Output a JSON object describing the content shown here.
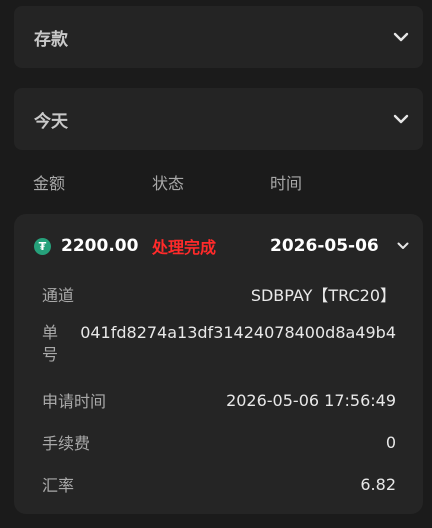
{
  "filters": {
    "type_label": "存款",
    "date_label": "今天"
  },
  "columns": [
    "金额",
    "状态",
    "时间"
  ],
  "record": {
    "coin_icon": "tether-icon",
    "coin_symbol": "₮",
    "amount": "2200.00",
    "status": "处理完成",
    "status_color": "#ff2a2a",
    "date": "2026-05-06",
    "details": {
      "channel_label": "通道",
      "channel_value": "SDBPAY【TRC20】",
      "order_label": "单号",
      "order_value": "041fd8274a13df31424078400d8a49b4",
      "time_label": "申请时间",
      "time_value": "2026-05-06 17:56:49",
      "fee_label": "手续费",
      "fee_value": "0",
      "rate_label": "汇率",
      "rate_value": "6.82"
    }
  }
}
